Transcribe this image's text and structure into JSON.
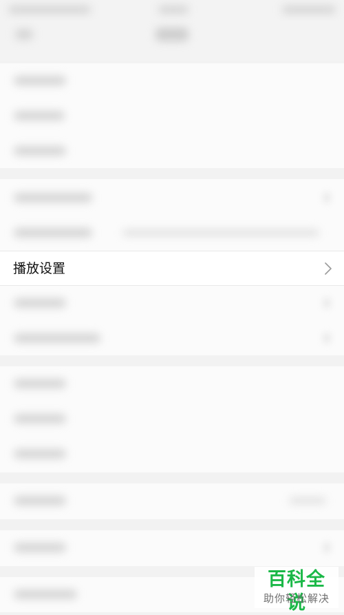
{
  "settings_list": {
    "playback_settings_label": "播放设置",
    "playback_settings_chevron_icon": "chevron-right-icon"
  },
  "watermark": {
    "brand": "百科全说",
    "tagline": "助你轻松解决",
    "brand_color": "#1ab847"
  },
  "colors": {
    "page_background": "#f2f2f2",
    "active_row_background": "#ffffff"
  }
}
